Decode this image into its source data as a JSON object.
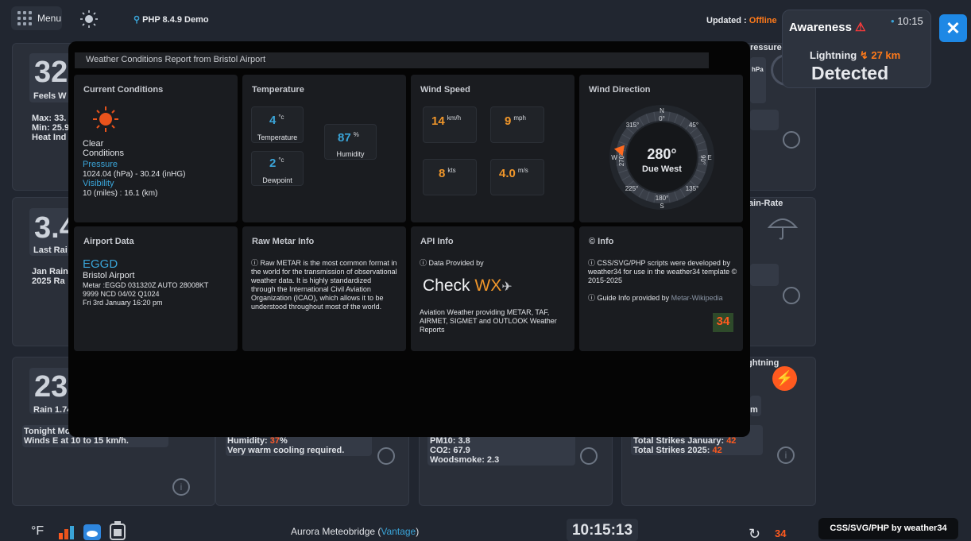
{
  "topbar": {
    "menu_label": "Menu",
    "php_label": "PHP 8.4.9 Demo",
    "updated_label": "Updated :",
    "updated_status": "Offline"
  },
  "background": {
    "temp_value": "32",
    "feels_partial": "Feels W",
    "max_partial": "Max: 33.",
    "min_partial": "Min: 25.9",
    "heat_partial": "Heat Ind",
    "pressure_partial": "ressure",
    "hpa_partial": "hPa",
    "rain_value": "3.4",
    "last_rain_partial": "Last Rai",
    "jan_rain_partial": "Jan Rain",
    "rain_2025_partial": "2025 Ra",
    "rain_rate_partial": "ain-Rate",
    "forecast_value": "23",
    "rain_small_partial": "Rain 1.74",
    "tonight_partial": "Tonight Mo",
    "winds_text": "Winds E at 10 to 15 km/h.",
    "humidity_label": "Humidity:",
    "humidity_value": "37",
    "humidity_unit": "%",
    "humidity_note": "Very warm cooling required.",
    "pm10": "PM10: 3.8",
    "co2": "CO2: 67.9",
    "woodsmoke": "Woodsmoke: 2.3",
    "lightning_partial": "ightning",
    "m_partial": "m",
    "strikes_jan_label": "Total Strikes January:",
    "strikes_jan_value": "42",
    "strikes_2025_label": "Total Strikes 2025:",
    "strikes_2025_value": "42"
  },
  "awareness": {
    "title": "Awareness",
    "time": "10:15",
    "lightning_label": "Lightning",
    "lightning_distance": "27 km",
    "status": "Detected"
  },
  "close_label": "✕",
  "modal": {
    "header": "Weather Conditions Report from Bristol Airport",
    "current": {
      "title": "Current Conditions",
      "condition_line1": "Clear",
      "condition_line2": "Conditions",
      "pressure_label": "Pressure",
      "pressure_value": "1024.04 (hPa) - 30.24 (inHG)",
      "visibility_label": "Visibility",
      "visibility_value": "10 (miles) : 16.1 (km)"
    },
    "temperature": {
      "title": "Temperature",
      "temp_value": "4",
      "temp_unit": "°c",
      "temp_caption": "Temperature",
      "dew_value": "2",
      "dew_unit": "°c",
      "dew_caption": "Dewpoint",
      "hum_value": "87",
      "hum_unit": "%",
      "hum_caption": "Humidity"
    },
    "wind_speed": {
      "title": "Wind Speed",
      "kmh_value": "14",
      "kmh_unit": "km/h",
      "mph_value": "9",
      "mph_unit": "mph",
      "kts_value": "8",
      "kts_unit": "kts",
      "ms_value": "4.0",
      "ms_unit": "m/s"
    },
    "wind_direction": {
      "title": "Wind Direction",
      "degrees": "280°",
      "direction": "Due West",
      "bearing_deg": 280,
      "n": "N",
      "n_deg": "0°",
      "e": "E",
      "e_deg": "90°",
      "s": "S",
      "s_deg": "180°",
      "w": "W",
      "w_deg": "270°",
      "ne_deg": "45°",
      "se_deg": "135°",
      "sw_deg": "225°",
      "nw_deg": "315°"
    },
    "airport": {
      "title": "Airport Data",
      "code": "EGGD",
      "name": "Bristol Airport",
      "metar_line1": "Metar :EGGD 031320Z AUTO 28008KT",
      "metar_line2": "9999 NCD 04/02 Q1024",
      "date": "Fri 3rd January 16:20 pm"
    },
    "raw_metar": {
      "title": "Raw Metar Info",
      "text": "Raw METAR is the most common format in the world for the transmission of observational weather data. It is highly standardized through the International Civil Aviation Organization (ICAO), which allows it to be understood throughout most of the world."
    },
    "api": {
      "title": "API Info",
      "provided_by": "Data Provided by",
      "logo_text1": "Check",
      "logo_text2": "WX",
      "description": "Aviation Weather providing METAR, TAF, AIRMET, SIGMET and OUTLOOK Weather Reports"
    },
    "info": {
      "title": "Info",
      "credit_text": "CSS/SVG/PHP scripts were developed by weather34 for use in the weather34 template © 2015-2025",
      "guide_text": "Guide Info provided by",
      "guide_link": "Metar-Wikipedia",
      "badge": "34"
    }
  },
  "bottombar": {
    "units": "°F",
    "station_prefix": "Aurora Meteobridge (",
    "station_link": "Vantage",
    "station_suffix": ")",
    "clock": "10:15:13",
    "badge": "34"
  },
  "credit": "CSS/SVG/PHP by weather34"
}
